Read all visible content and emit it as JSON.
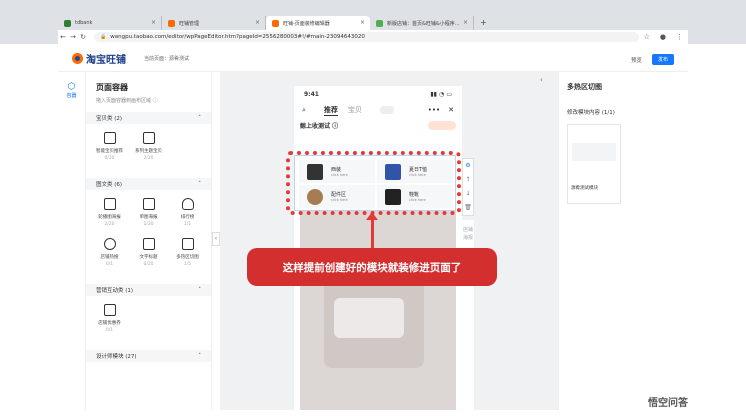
{
  "browser": {
    "tabs": [
      {
        "label": "tdbank",
        "color": "#2e7d32"
      },
      {
        "label": "旺铺管理",
        "color": "#ff6a00"
      },
      {
        "label": "旺铺-页面装修编辑器",
        "color": "#ff6a00"
      },
      {
        "label": "新版店铺：首页&旺铺&小程序…",
        "color": "#4caf50"
      }
    ],
    "new_tab": "+",
    "url": "wangpu.taobao.com/editor/wpPageEditor.htm?pageId=2556280003#!/#main-23094643020"
  },
  "app": {
    "logo_text": "淘宝旺铺",
    "current_page": "当前页面：源肴测试",
    "preview": "预览",
    "publish": "发布"
  },
  "rail": {
    "label": "容器"
  },
  "panel": {
    "title": "页面容器",
    "hint": "拖入页面容器到画布区域 ⓘ",
    "sections": [
      {
        "name": "宝贝类 (2)",
        "items": [
          {
            "label": "智能宝贝推荐",
            "count": "0/20"
          },
          {
            "label": "系列主题宝贝",
            "count": "2/20"
          }
        ]
      },
      {
        "name": "图文类 (6)",
        "items": [
          {
            "label": "轮播图海报",
            "count": "2/20"
          },
          {
            "label": "单图海报",
            "count": "1/20"
          },
          {
            "label": "排行榜",
            "count": "1/1"
          },
          {
            "label": "店铺热搜",
            "count": "0/1"
          },
          {
            "label": "文字标题",
            "count": "0/20"
          },
          {
            "label": "多热区切图",
            "count": "1/5"
          }
        ]
      },
      {
        "name": "营销互动类 (1)",
        "items": [
          {
            "label": "店铺优惠券",
            "count": "0/1"
          }
        ]
      },
      {
        "name": "设计师模块 (27)",
        "items": []
      }
    ]
  },
  "phone": {
    "time": "9:41",
    "tab_active": "推荐",
    "tab_other": "宝贝",
    "shop_name": "鲸上收测试 ⓘ",
    "cards": [
      {
        "title": "西装",
        "sub": "click here"
      },
      {
        "title": "夏日T恤",
        "sub": "click here"
      },
      {
        "title": "配件区",
        "sub": "click here"
      },
      {
        "title": "鞋靴",
        "sub": "click here"
      }
    ],
    "side_label": "店铺海报"
  },
  "callout": "这样提前创建好的模块就装修进页面了",
  "right_panel": {
    "title": "多热区切图",
    "subtitle": "修改模块内容 (1/1)",
    "thumb_label": "源肴测试模块"
  },
  "watermark": "悟空问答"
}
